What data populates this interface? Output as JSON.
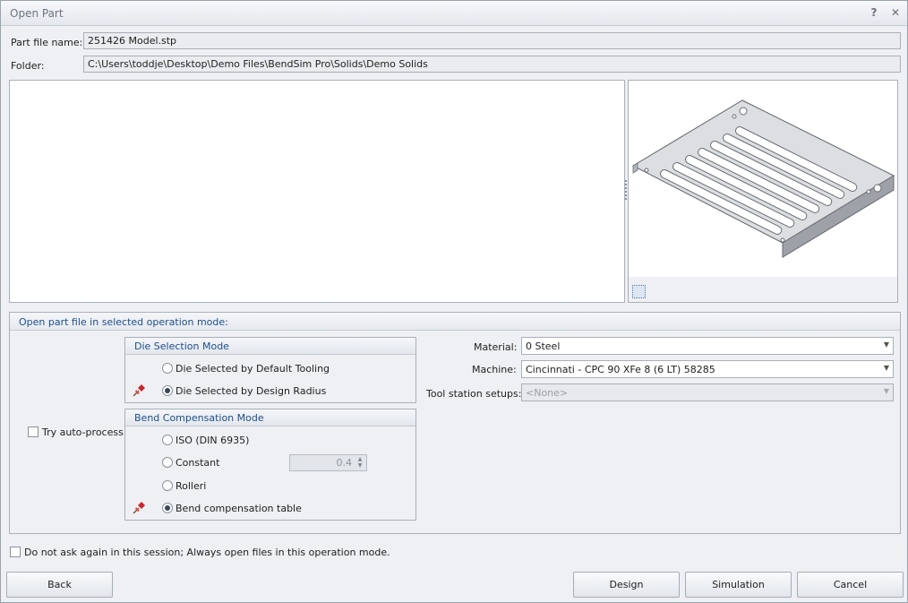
{
  "window": {
    "title": "Open Part",
    "help_glyph": "?",
    "close_glyph": "✕"
  },
  "part": {
    "name_label": "Part file name:",
    "name_value": "251426 Model.stp",
    "folder_label": "Folder:",
    "folder_value": "C:\\Users\\toddje\\Desktop\\Demo Files\\BendSim Pro\\Solids\\Demo Solids"
  },
  "mode_group": {
    "title": "Open part file in selected operation mode:"
  },
  "die_selection": {
    "title": "Die Selection Mode",
    "options": [
      {
        "label": "Die Selected by Default Tooling",
        "selected": false
      },
      {
        "label": "Die Selected by Design Radius",
        "selected": true
      }
    ]
  },
  "bend_compensation": {
    "title": "Bend Compensation Mode",
    "options": [
      {
        "label": "ISO (DIN 6935)",
        "selected": false
      },
      {
        "label": "Constant",
        "selected": false
      },
      {
        "label": "Rolleri",
        "selected": false
      },
      {
        "label": "Bend compensation table",
        "selected": true
      }
    ],
    "constant_value": "0.4"
  },
  "auto_process": {
    "label": "Try auto-process",
    "checked": false
  },
  "settings": {
    "material_label": "Material:",
    "material_value": "0 Steel",
    "machine_label": "Machine:",
    "machine_value": "Cincinnati - CPC 90 XFe 8 (6 LT) 58285",
    "tool_label": "Tool station setups:",
    "tool_value": "<None>"
  },
  "dont_ask": {
    "label": "Do not ask again in this session; Always open files in this operation mode.",
    "checked": false
  },
  "buttons": {
    "back": "Back",
    "design": "Design",
    "simulation": "Simulation",
    "cancel": "Cancel"
  },
  "icons": {
    "pin": "red-pushpin-icon",
    "preview": "sheet-metal-part-preview"
  },
  "colors": {
    "accent_text": "#1e4e8c",
    "pin": "#c8282e"
  }
}
